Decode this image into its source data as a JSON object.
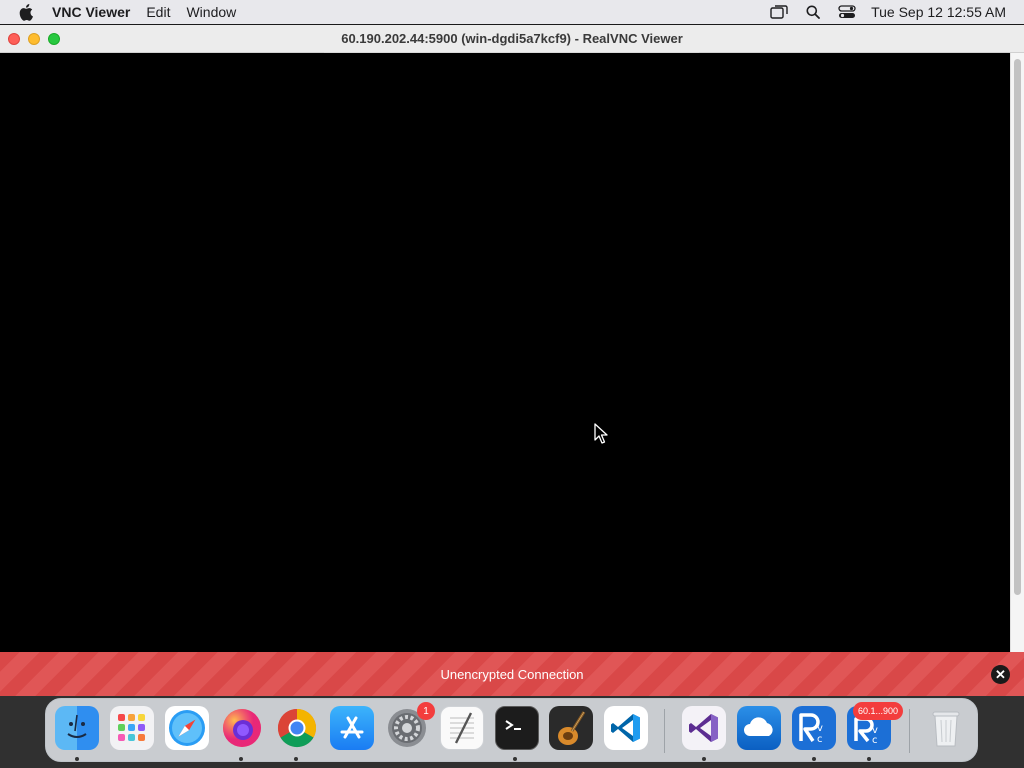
{
  "menubar": {
    "app_name": "VNC Viewer",
    "items": [
      "Edit",
      "Window"
    ],
    "clock": "Tue Sep 12  12:55 AM",
    "status_icons": [
      "screen-mirroring-icon",
      "search-icon",
      "control-center-icon"
    ]
  },
  "window": {
    "title": "60.190.202.44:5900 (win-dgdi5a7kcf9) - RealVNC Viewer"
  },
  "warning": {
    "text": "Unencrypted Connection",
    "close_icon": "close-icon"
  },
  "dock": {
    "apps": [
      {
        "name": "finder",
        "running": true
      },
      {
        "name": "launchpad",
        "running": false
      },
      {
        "name": "safari",
        "running": false
      },
      {
        "name": "firefox",
        "running": true
      },
      {
        "name": "chrome",
        "running": true
      },
      {
        "name": "app-store",
        "running": false
      },
      {
        "name": "system-preferences",
        "running": false,
        "badge": "1"
      },
      {
        "name": "textedit",
        "running": false
      },
      {
        "name": "terminal",
        "running": true
      },
      {
        "name": "garageband",
        "running": false
      },
      {
        "name": "vscode",
        "running": false
      },
      {
        "name": "visual-studio",
        "running": true
      },
      {
        "name": "onedrive",
        "running": false
      },
      {
        "name": "realvnc-viewer",
        "running": true
      },
      {
        "name": "realvnc-viewer-window",
        "running": true,
        "badge": "60.1...900"
      },
      {
        "name": "trash",
        "running": false
      }
    ]
  },
  "colors": {
    "warning_red": "#d94848",
    "badge_red": "#f33d3d"
  }
}
